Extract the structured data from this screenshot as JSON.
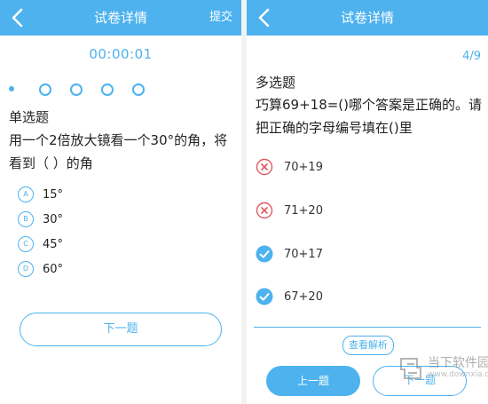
{
  "left": {
    "header": {
      "title": "试卷详情",
      "submit_label": "提交"
    },
    "timer": "00:00:01",
    "question": {
      "type": "单选题",
      "text": "用一个2倍放大镜看一个30°的角，将看到（  ）的角",
      "options": [
        {
          "key": "A",
          "text": "15°"
        },
        {
          "key": "B",
          "text": "30°"
        },
        {
          "key": "C",
          "text": "45°"
        },
        {
          "key": "D",
          "text": "60°"
        }
      ]
    },
    "next_label": "下一题"
  },
  "right": {
    "header": {
      "title": "试卷详情"
    },
    "page_count": "4/9",
    "question": {
      "type": "多选题",
      "text": "巧算69+18=()哪个答案是正确的。请把正确的字母编号填在()里",
      "options": [
        {
          "text": "70+19",
          "status": "wrong"
        },
        {
          "text": "71+20",
          "status": "wrong"
        },
        {
          "text": "70+17",
          "status": "correct"
        },
        {
          "text": "67+20",
          "status": "correct"
        }
      ]
    },
    "analysis_label": "查看解析",
    "prev_label": "上一题",
    "next_label": "下一题"
  },
  "watermark": {
    "line1": "当下软件园",
    "line2": "www.downxia.com"
  },
  "colors": {
    "accent": "#4db2ee",
    "wrong": "#e05a63",
    "text": "#222222"
  },
  "icons": {
    "back": "chevron-left-icon",
    "wrong": "x-circle-icon",
    "correct": "check-circle-icon"
  }
}
